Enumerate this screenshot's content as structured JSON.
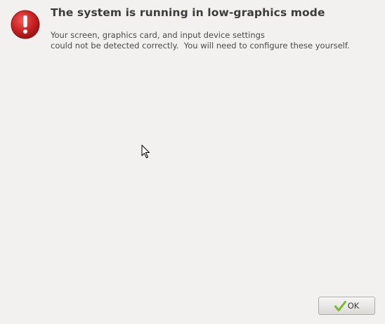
{
  "dialog": {
    "title": "The system is running in low-graphics mode",
    "message": "Your screen, graphics card, and input device settings\ncould not be detected correctly.  You will need to configure these yourself.",
    "icon": "error-icon",
    "accent_color": "#cc2222"
  },
  "buttons": {
    "ok_label": "OK",
    "ok_icon": "check-icon"
  }
}
